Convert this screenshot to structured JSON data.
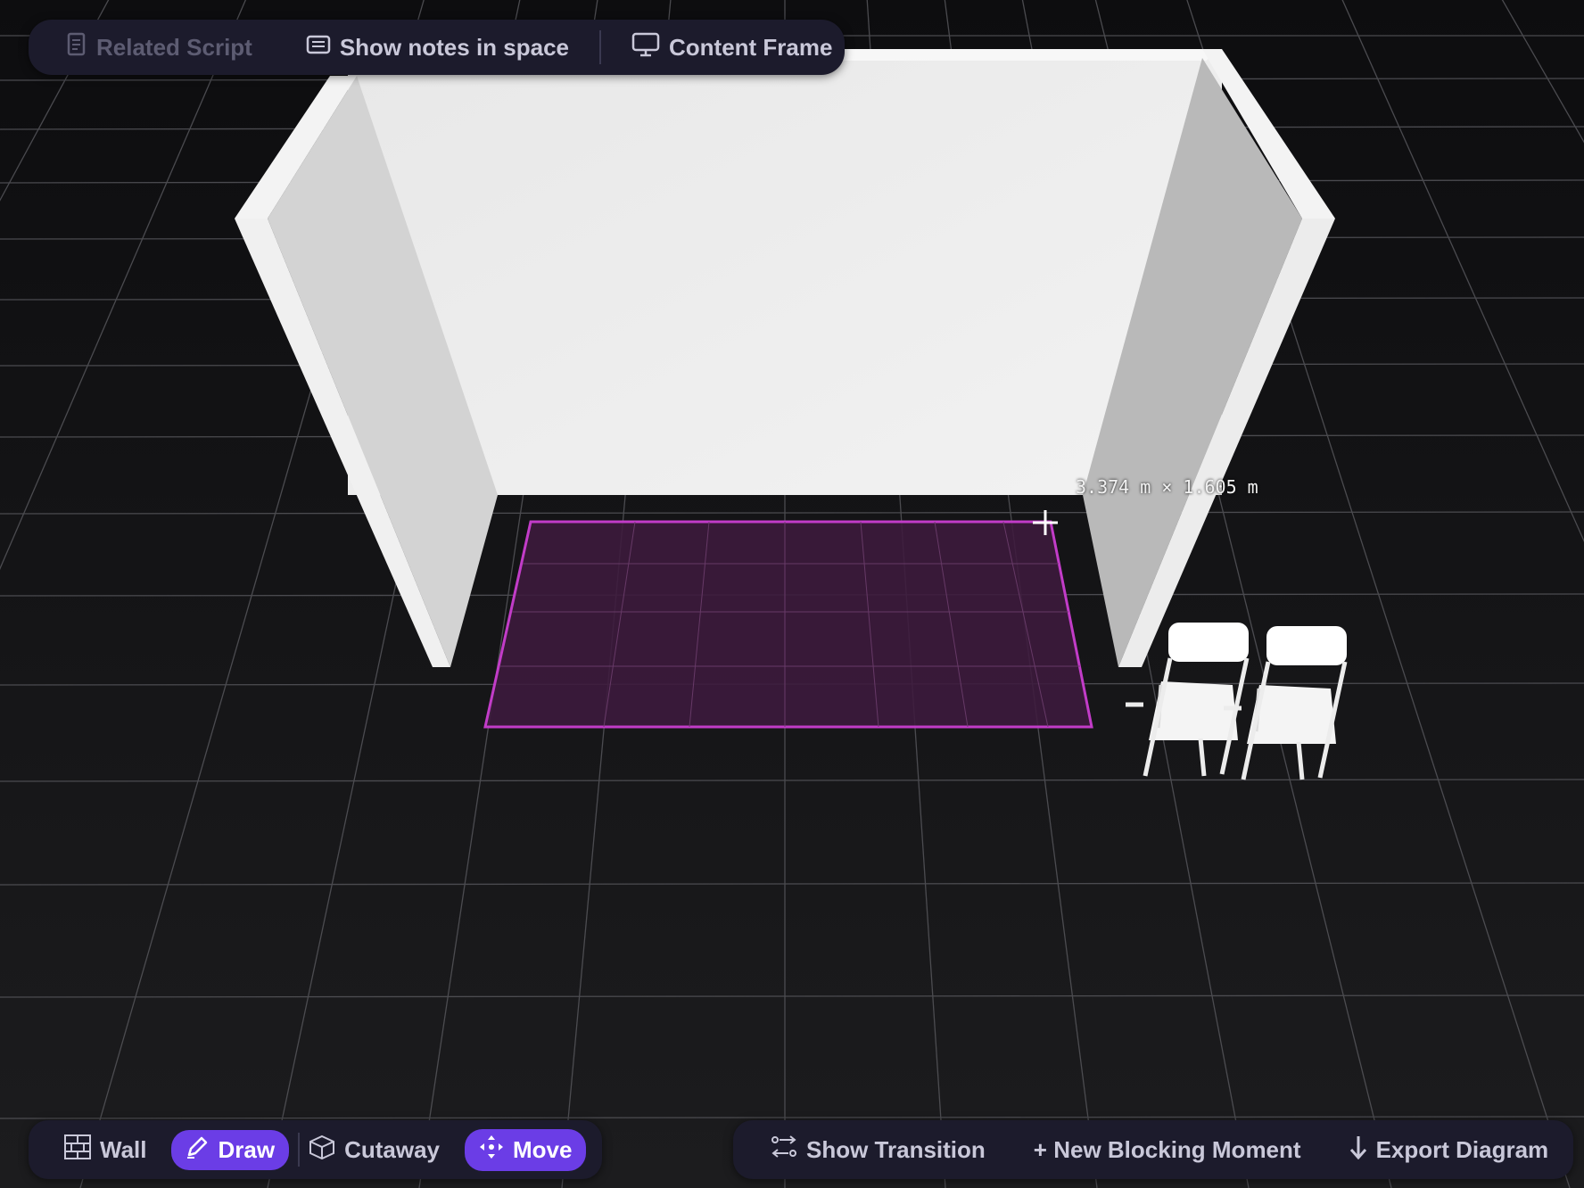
{
  "top_toolbar": {
    "related_script": "Related Script",
    "show_notes": "Show notes in space",
    "content_frame": "Content Frame"
  },
  "bottom_left_toolbar": {
    "wall": "Wall",
    "draw": "Draw",
    "cutaway": "Cutaway",
    "move": "Move"
  },
  "bottom_right_toolbar": {
    "show_transition": "Show Transition",
    "new_blocking_moment": "+ New Blocking Moment",
    "export_diagram": "Export Diagram"
  },
  "scene": {
    "dimension_label": "3.374 m × 1.605 m"
  },
  "colors": {
    "accent": "#6b3de6",
    "selection_stroke": "#c23cc8",
    "selection_fill": "#3d1a3e",
    "toolbar_bg": "#1c1b2c"
  },
  "icons": {
    "related_script": "document-icon",
    "show_notes": "notes-icon",
    "content_frame": "monitor-icon",
    "wall": "brick-icon",
    "draw": "pencil-icon",
    "cutaway": "cube-icon",
    "move": "move-arrows-icon",
    "show_transition": "transition-icon",
    "export_diagram": "arrow-down-icon"
  }
}
